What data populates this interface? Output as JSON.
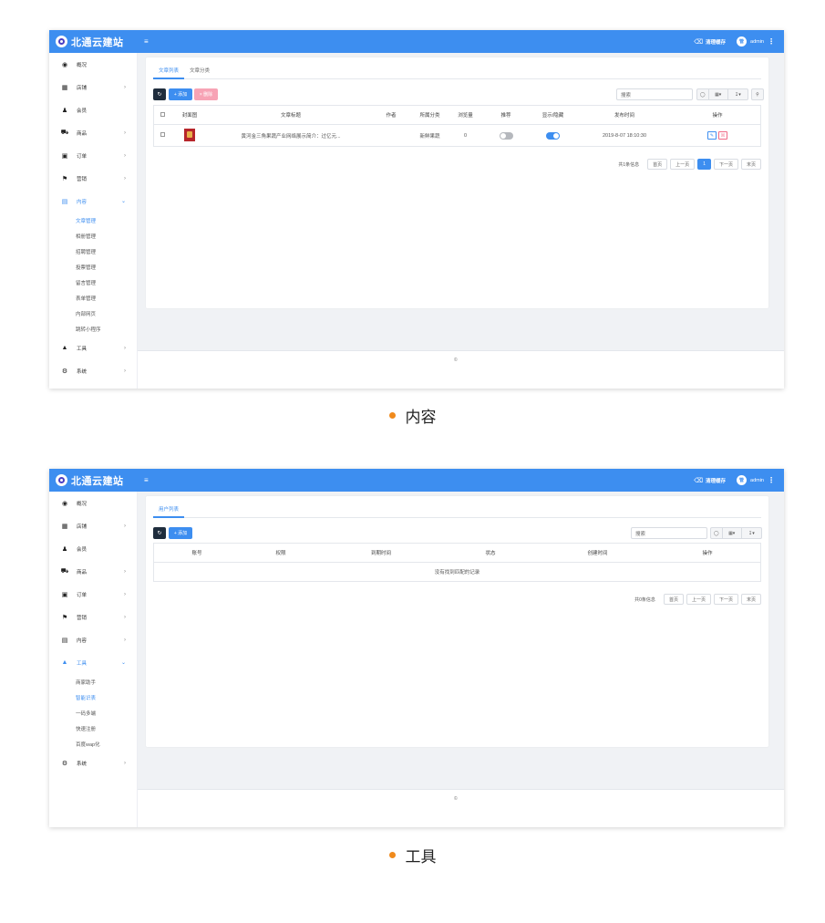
{
  "colors": {
    "accent": "#3d8ef0",
    "caption_dot": "#f08a1c",
    "danger": "#f06a86"
  },
  "app": {
    "logo_text": "北通云建站",
    "menu_icon": "hamburger-icon",
    "clean_cache": "清理缓存",
    "avatar": "管",
    "user": "admin"
  },
  "screens": [
    {
      "caption": "内容",
      "sidebar": [
        {
          "icon": "dashboard-icon",
          "label": "概况"
        },
        {
          "icon": "grid-icon",
          "label": "店铺"
        },
        {
          "icon": "users-icon",
          "label": "会员"
        },
        {
          "icon": "cart-icon",
          "label": "商品"
        },
        {
          "icon": "order-icon",
          "label": "订单"
        },
        {
          "icon": "flag-icon",
          "label": "营销"
        },
        {
          "icon": "document-icon",
          "label": "内容"
        },
        {
          "icon": "cube-icon",
          "label": "工具"
        },
        {
          "icon": "gear-icon",
          "label": "系统"
        }
      ],
      "subitems": [
        "文章管理",
        "相册管理",
        "招聘管理",
        "投票管理",
        "留言管理",
        "表单管理",
        "内部网页",
        "跳转小程序"
      ],
      "tabs": [
        "文章列表",
        "文章分类"
      ],
      "buttons": {
        "add": "+ 添加",
        "delete": "× 删除"
      },
      "search_placeholder": "搜索",
      "table": {
        "headers": [
          "封面图",
          "文章标题",
          "作者",
          "所属分类",
          "浏览量",
          "推荐",
          "显示/隐藏",
          "发布时间",
          "操作"
        ],
        "rows": [
          {
            "title": "黄河金三角果蔬产业网络展示简介：过亿元...",
            "author": "",
            "category": "新鲜果蔬",
            "views": "0",
            "recommend": false,
            "visible": true,
            "date": "2019-8-07 18:10:30"
          }
        ]
      },
      "pager": {
        "info": "共1条信息",
        "first": "首页",
        "prev": "上一页",
        "current": "1",
        "next": "下一页",
        "last": "末页"
      },
      "footer": "©"
    },
    {
      "caption": "工具",
      "subitems": [
        "商家助手",
        "智能识表",
        "一码多端",
        "快速注册",
        "百度wap化"
      ],
      "tabs": [
        "用户列表"
      ],
      "buttons": {
        "add": "+ 添加"
      },
      "search_placeholder": "搜索",
      "table": {
        "headers": [
          "账号",
          "权限",
          "到期时间",
          "状态",
          "创建时间",
          "操作"
        ],
        "empty": "没有找到匹配的记录"
      },
      "pager": {
        "info": "共0条信息",
        "first": "首页",
        "prev": "上一页",
        "next": "下一页",
        "last": "末页"
      },
      "footer": "©"
    }
  ]
}
